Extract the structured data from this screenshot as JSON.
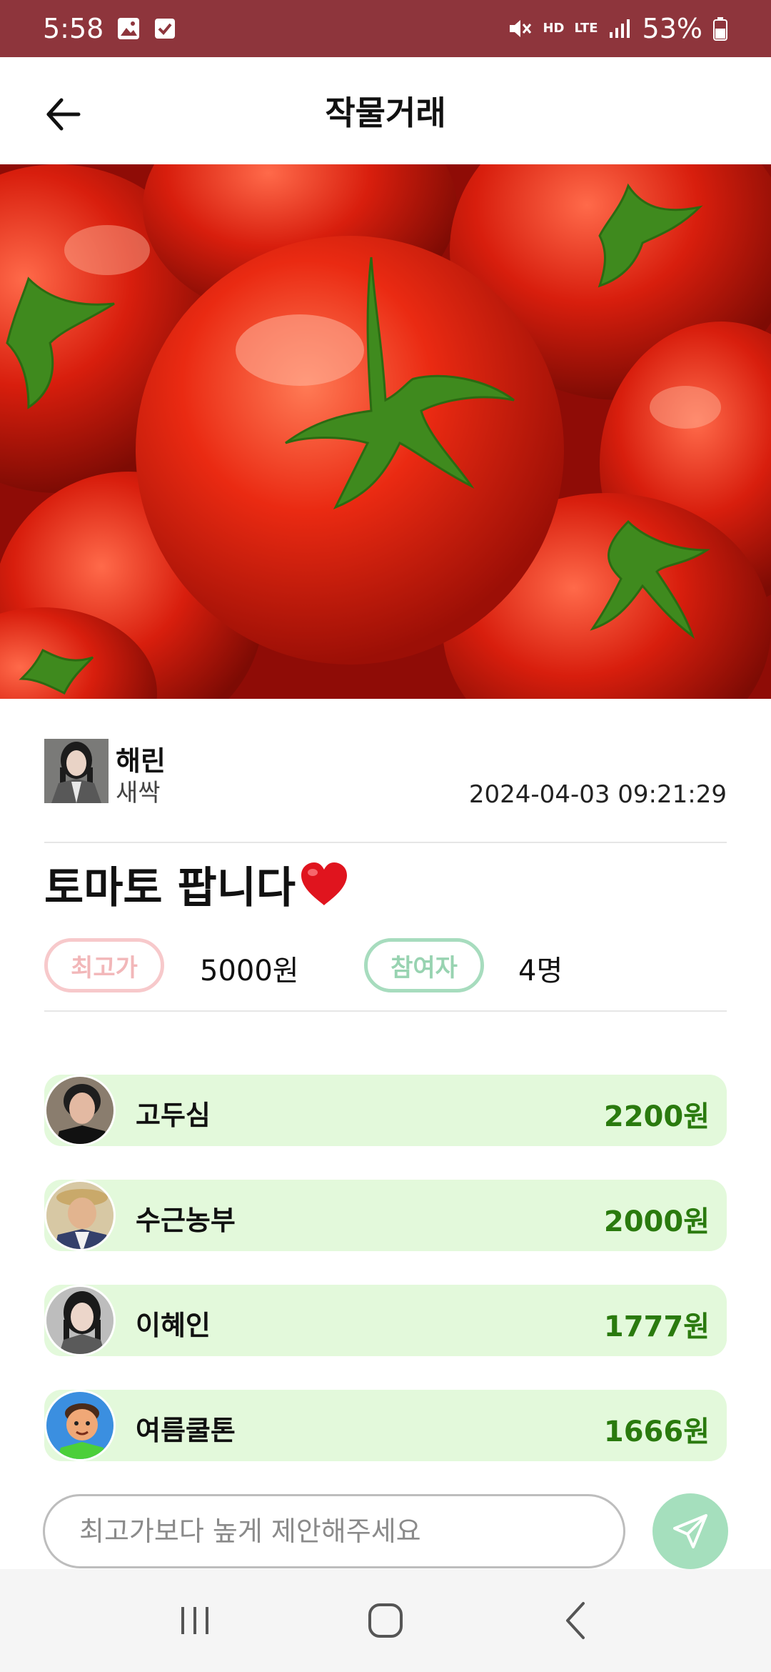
{
  "status_bar": {
    "time": "5:58",
    "battery": "53%",
    "hd_label": "HD",
    "lte_label": "LTE",
    "icons": [
      "gallery-icon",
      "checkbox-icon",
      "mute-icon",
      "signal-icon",
      "battery-icon"
    ]
  },
  "header": {
    "title": "작물거래",
    "back_icon": "arrow-left-icon"
  },
  "seller": {
    "name": "해린",
    "grade": "새싹",
    "date": "2024-04-03 09:21:29"
  },
  "post": {
    "title": "토마토 팝니다",
    "emoji": "heart-icon"
  },
  "stats": {
    "max_label": "최고가",
    "max_value": "5000원",
    "participants_label": "참여자",
    "participants_value": "4명"
  },
  "bids": [
    {
      "name": "고두심",
      "amount": "2200원"
    },
    {
      "name": "수근농부",
      "amount": "2000원"
    },
    {
      "name": "이혜인",
      "amount": "1777원"
    },
    {
      "name": "여름쿨톤",
      "amount": "1666원"
    }
  ],
  "offer": {
    "placeholder": "최고가보다 높게 제안해주세요"
  },
  "colors": {
    "status_bar": "#8e353c",
    "bid_row_bg": "#e3f9db",
    "bid_amount": "#2a7a0e",
    "pill_max": "#f7c9cb",
    "pill_participants": "#a7dcbe",
    "send_button": "#a5dfbd"
  }
}
